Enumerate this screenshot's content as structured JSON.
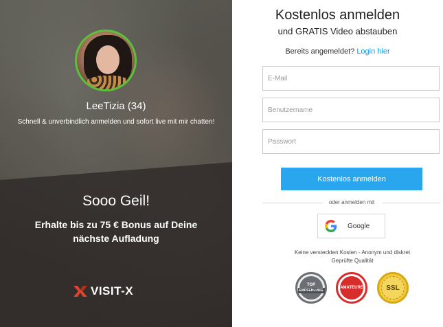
{
  "left": {
    "profile": {
      "name": "LeeTizia",
      "age": "(34)"
    },
    "tagline": "Schnell & unverbindlich anmelden und sofort live mit mir chatten!",
    "headline": "Sooo Geil!",
    "bonus_line1": "Erhalte bis zu 75 € Bonus auf Deine",
    "bonus_line2": "nächste Aufladung",
    "logo_text": "VISIT-X"
  },
  "form": {
    "title": "Kostenlos anmelden",
    "subtitle": "und GRATIS Video abstauben",
    "already_text": "Bereits angemeldet?",
    "login_link": "Login hier",
    "email_placeholder": "E-Mail",
    "username_placeholder": "Benutzername",
    "password_placeholder": "Passwort",
    "submit_label": "Kostenlos anmelden",
    "or_text": "oder anmelden mit",
    "google_label": "Google",
    "disclaimer_line1": "Keine versteckten Kosten - Anonym und diskret",
    "disclaimer_line2": "Geprüfte Qualität"
  },
  "seals": {
    "top_line1": "TOP",
    "top_line2": "EMPFEHLUNG",
    "amateure": "AMATEURE",
    "ssl": "SSL"
  },
  "colors": {
    "accent": "#2aa6ef",
    "link": "#1e96d8",
    "avatar_ring": "#5cc13a",
    "logo_mark": "#e0442b"
  }
}
